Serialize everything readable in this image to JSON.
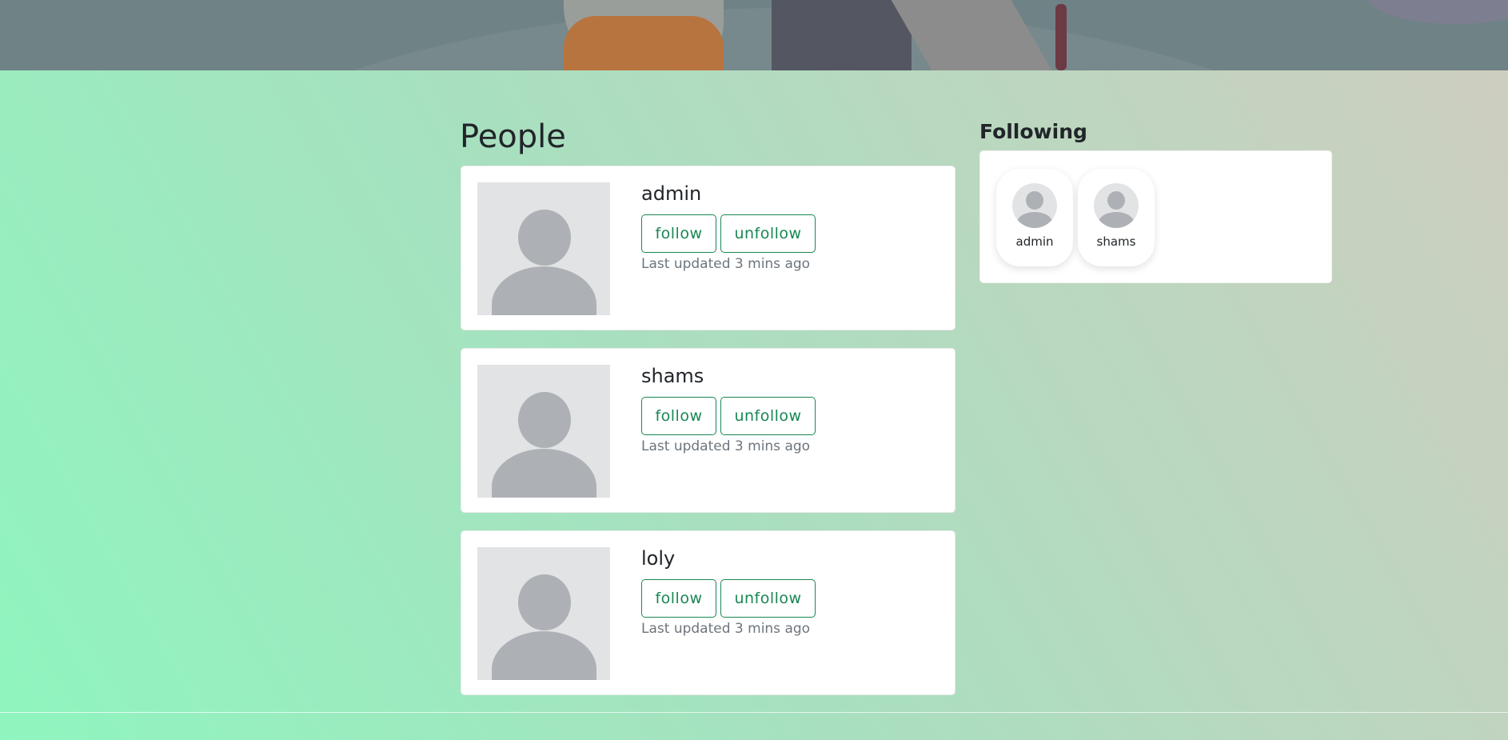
{
  "page": {
    "people_heading": "People",
    "following_heading": "Following"
  },
  "people": [
    {
      "name": "admin",
      "follow_label": "follow",
      "unfollow_label": "unfollow",
      "updated": "Last updated 3 mins ago"
    },
    {
      "name": "shams",
      "follow_label": "follow",
      "unfollow_label": "unfollow",
      "updated": "Last updated 3 mins ago"
    },
    {
      "name": "loly",
      "follow_label": "follow",
      "unfollow_label": "unfollow",
      "updated": "Last updated 3 mins ago"
    }
  ],
  "following": [
    {
      "name": "admin"
    },
    {
      "name": "shams"
    }
  ],
  "colors": {
    "accent": "#198754",
    "muted_text": "#6c757d",
    "avatar_bg": "#e2e3e5",
    "avatar_fg": "#adb1b5"
  },
  "icons": {
    "avatar": "person-placeholder-icon"
  }
}
